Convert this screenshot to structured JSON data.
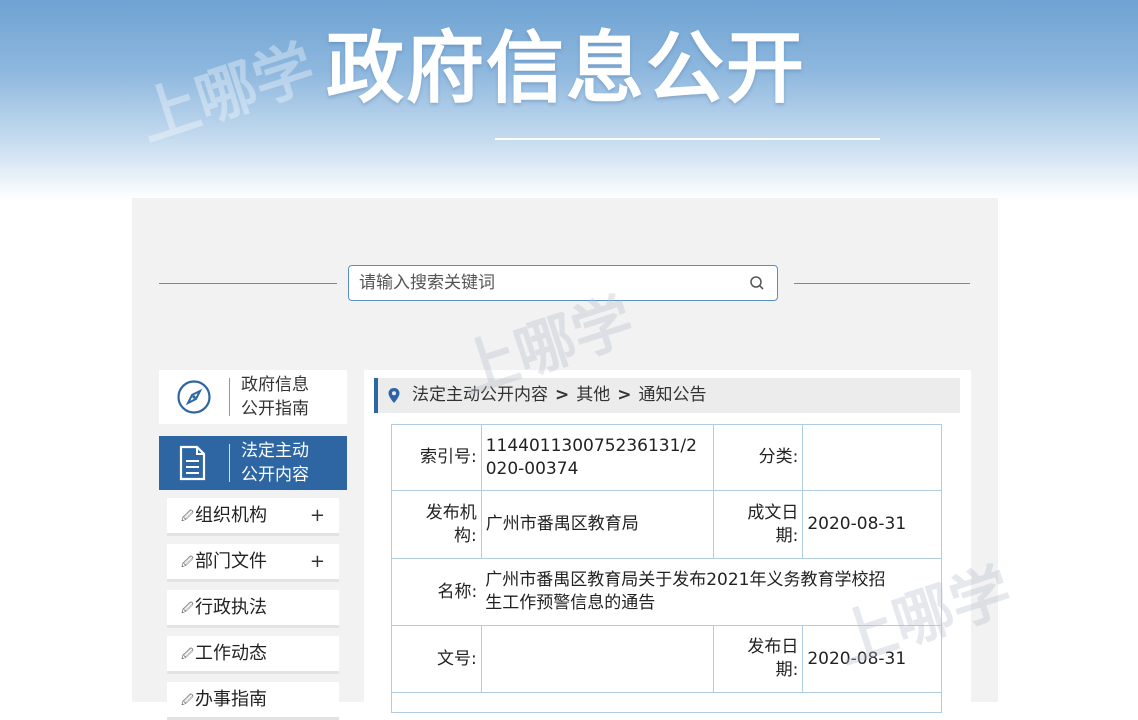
{
  "banner": {
    "title": "政府信息公开",
    "watermark": "上哪学"
  },
  "search": {
    "placeholder": "请输入搜索关键词",
    "icon": "search-icon"
  },
  "sidebar": {
    "guide": {
      "label_line1": "政府信息",
      "label_line2": "公开指南",
      "icon": "compass-icon"
    },
    "active": {
      "label_line1": "法定主动",
      "label_line2": "公开内容",
      "icon": "document-icon"
    },
    "items": [
      {
        "label": "组织机构",
        "expand": "+"
      },
      {
        "label": "部门文件",
        "expand": "+"
      },
      {
        "label": "行政执法",
        "expand": ""
      },
      {
        "label": "工作动态",
        "expand": ""
      },
      {
        "label": "办事指南",
        "expand": ""
      }
    ]
  },
  "breadcrumb": {
    "icon": "location-pin-icon",
    "parts": [
      "法定主动公开内容",
      "其他",
      "通知公告"
    ],
    "separator": ">"
  },
  "info": {
    "index_label": "索引号:",
    "index_value_line1": "114401130075236131/2",
    "index_value_line2": "020-00374",
    "category_label": "分类:",
    "category_value": "",
    "publisher_label_line1": "发布机",
    "publisher_label_line2": "构:",
    "publisher_value": "广州市番禺区教育局",
    "created_label_line1": "成文日",
    "created_label_line2": "期:",
    "created_value": "2020-08-31",
    "name_label": "名称:",
    "name_value_line1": "广州市番禺区教育局关于发布2021年义务教育学校招",
    "name_value_line2": "生工作预警信息的通告",
    "docno_label": "文号:",
    "docno_value": "",
    "published_label_line1": "发布日",
    "published_label_line2": "期:",
    "published_value": "2020-08-31"
  },
  "colors": {
    "accent": "#2d66a3",
    "border": "#b0cde4"
  }
}
